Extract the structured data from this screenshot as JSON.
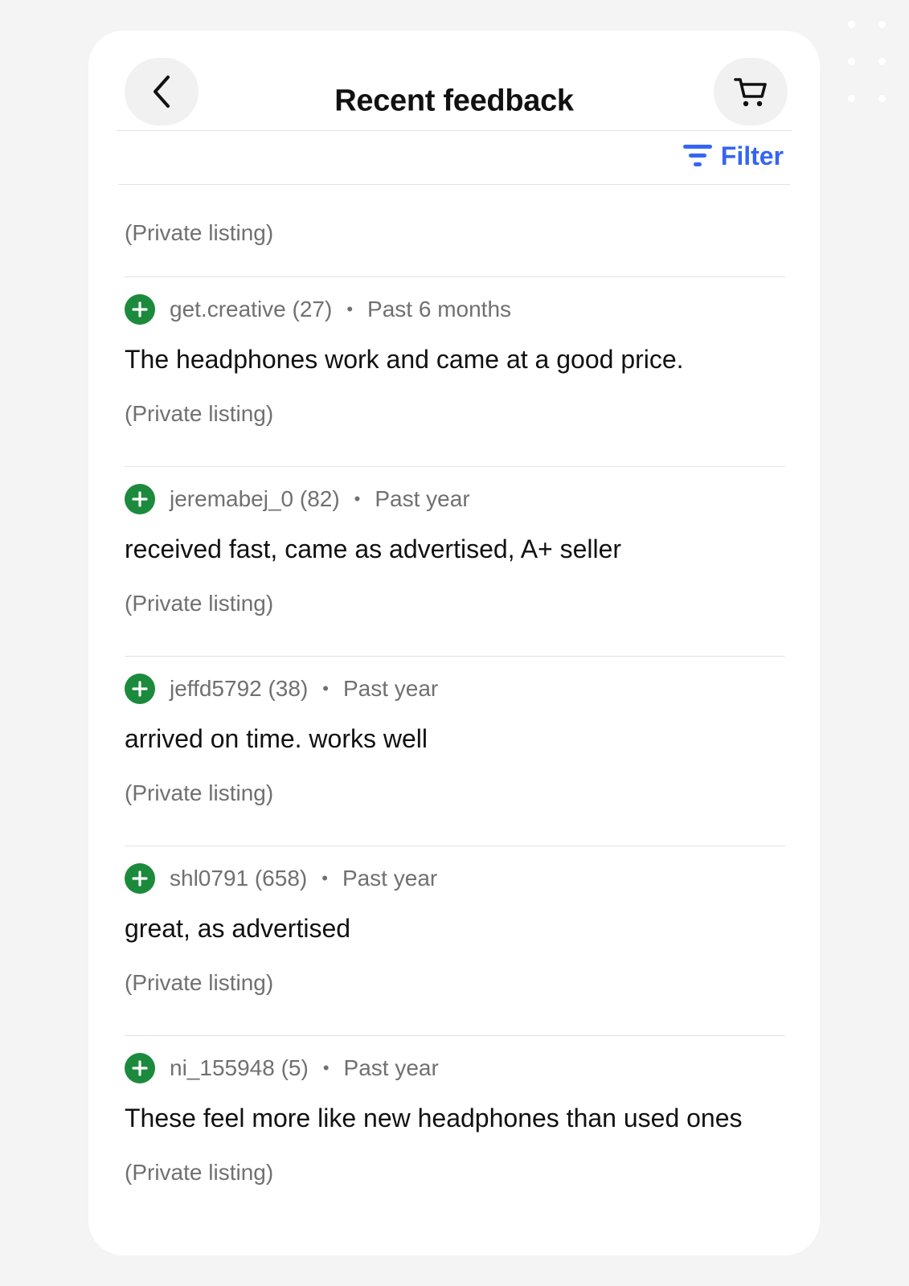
{
  "header": {
    "title": "Recent feedback",
    "back_icon": "chevron-left-icon",
    "cart_icon": "cart-icon"
  },
  "filter": {
    "label": "Filter",
    "icon": "filter-icon",
    "color": "#3665f3"
  },
  "top_listing": "(Private listing)",
  "accent_positive": "#1c8a3c",
  "feedback": [
    {
      "user": "get.creative (27)",
      "time": "Past 6 months",
      "comment": "The headphones work and came at a good price.",
      "listing": "(Private listing)"
    },
    {
      "user": "jeremabej_0 (82)",
      "time": "Past year",
      "comment": "received fast, came as advertised, A+ seller",
      "listing": "(Private listing)"
    },
    {
      "user": "jeffd5792 (38)",
      "time": "Past year",
      "comment": "arrived on time. works well",
      "listing": "(Private listing)"
    },
    {
      "user": "shl0791 (658)",
      "time": "Past year",
      "comment": "great, as advertised",
      "listing": "(Private listing)"
    },
    {
      "user": "ni_155948 (5)",
      "time": "Past year",
      "comment": "These feel more like new headphones than used ones",
      "listing": "(Private listing)"
    }
  ]
}
